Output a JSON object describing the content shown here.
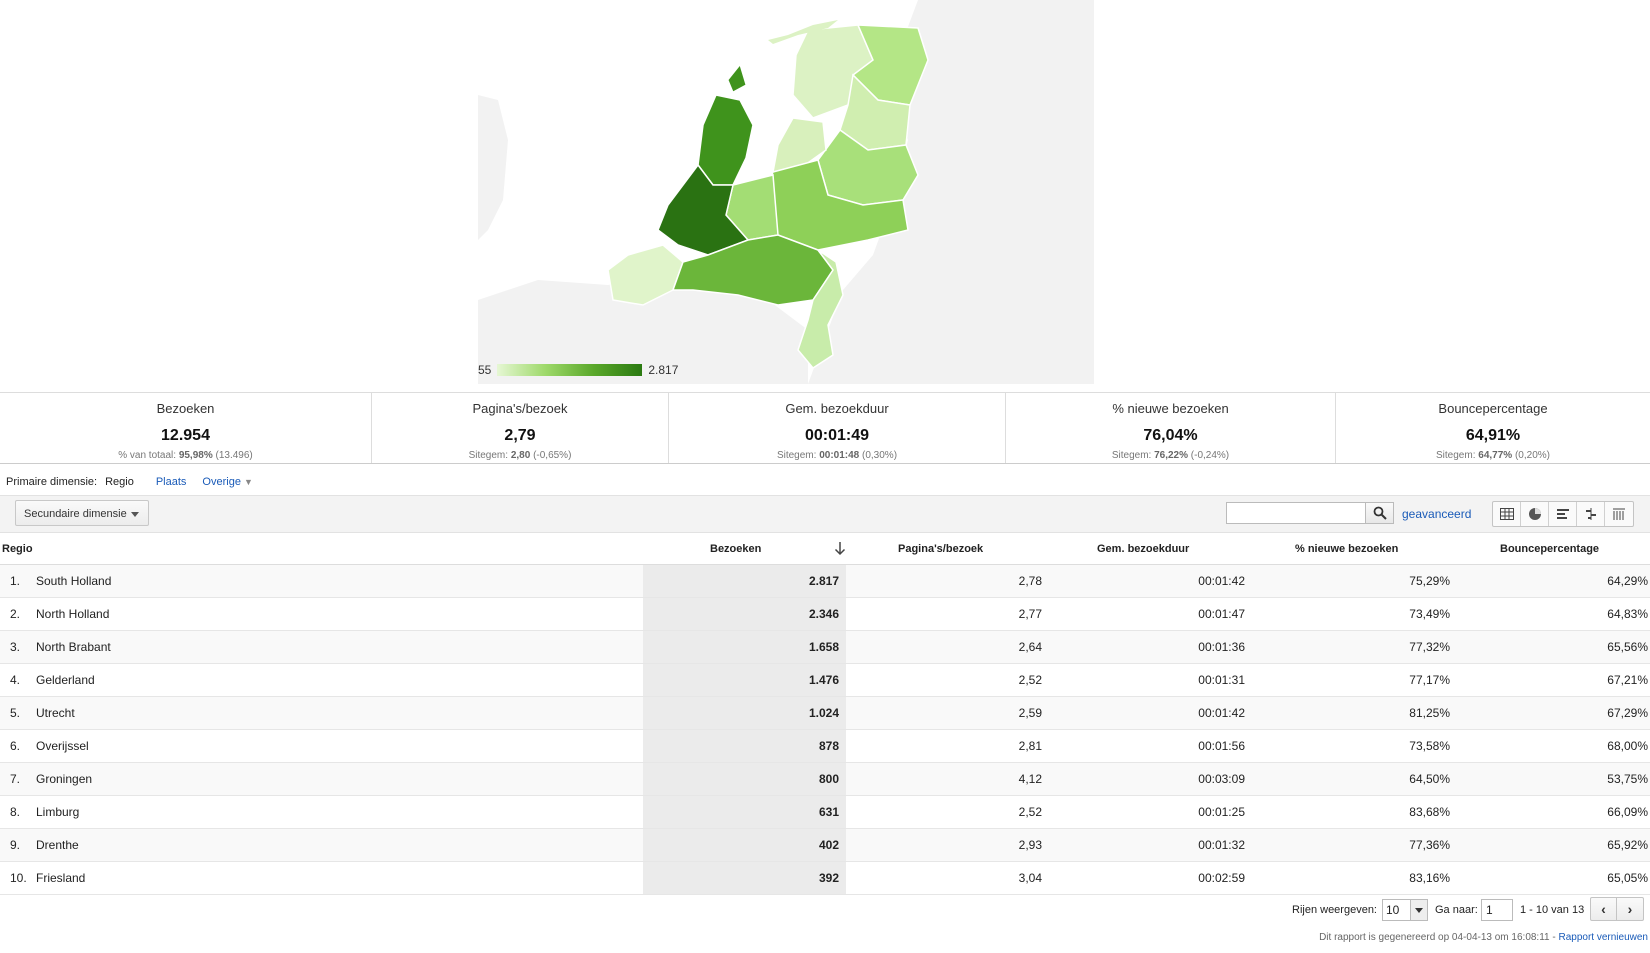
{
  "map": {
    "legend_min": "55",
    "legend_max": "2.817",
    "colors": {
      "low": "#e6f7d4",
      "mid": "#9ed96a",
      "high": "#2b7a12",
      "max": "#256e10",
      "land": "#f2f2f2"
    }
  },
  "summary": [
    {
      "title": "Bezoeken",
      "value": "12.954",
      "sub_label": "% van totaal:",
      "sub_strong": "95,98%",
      "sub_rest": "(13.496)"
    },
    {
      "title": "Pagina's/bezoek",
      "value": "2,79",
      "sub_label": "Sitegem:",
      "sub_strong": "2,80",
      "sub_rest": "(-0,65%)"
    },
    {
      "title": "Gem. bezoekduur",
      "value": "00:01:49",
      "sub_label": "Sitegem:",
      "sub_strong": "00:01:48",
      "sub_rest": "(0,30%)"
    },
    {
      "title": "% nieuwe bezoeken",
      "value": "76,04%",
      "sub_label": "Sitegem:",
      "sub_strong": "76,22%",
      "sub_rest": "(-0,24%)"
    },
    {
      "title": "Bouncepercentage",
      "value": "64,91%",
      "sub_label": "Sitegem:",
      "sub_strong": "64,77%",
      "sub_rest": "(0,20%)"
    }
  ],
  "dimension": {
    "label": "Primaire dimensie:",
    "selected": "Regio",
    "link1": "Plaats",
    "link2": "Overige"
  },
  "toolbar": {
    "secondary": "Secundaire dimensie",
    "search_placeholder": "",
    "advanced": "geavanceerd"
  },
  "table": {
    "headers": {
      "region": "Regio",
      "visits": "Bezoeken",
      "pages": "Pagina's/bezoek",
      "duration": "Gem. bezoekduur",
      "new": "% nieuwe bezoeken",
      "bounce": "Bouncepercentage"
    },
    "rows": [
      {
        "n": "1.",
        "region": "South Holland",
        "visits": "2.817",
        "pages": "2,78",
        "duration": "00:01:42",
        "new": "75,29%",
        "bounce": "64,29%"
      },
      {
        "n": "2.",
        "region": "North Holland",
        "visits": "2.346",
        "pages": "2,77",
        "duration": "00:01:47",
        "new": "73,49%",
        "bounce": "64,83%"
      },
      {
        "n": "3.",
        "region": "North Brabant",
        "visits": "1.658",
        "pages": "2,64",
        "duration": "00:01:36",
        "new": "77,32%",
        "bounce": "65,56%"
      },
      {
        "n": "4.",
        "region": "Gelderland",
        "visits": "1.476",
        "pages": "2,52",
        "duration": "00:01:31",
        "new": "77,17%",
        "bounce": "67,21%"
      },
      {
        "n": "5.",
        "region": "Utrecht",
        "visits": "1.024",
        "pages": "2,59",
        "duration": "00:01:42",
        "new": "81,25%",
        "bounce": "67,29%"
      },
      {
        "n": "6.",
        "region": "Overijssel",
        "visits": "878",
        "pages": "2,81",
        "duration": "00:01:56",
        "new": "73,58%",
        "bounce": "68,00%"
      },
      {
        "n": "7.",
        "region": "Groningen",
        "visits": "800",
        "pages": "4,12",
        "duration": "00:03:09",
        "new": "64,50%",
        "bounce": "53,75%"
      },
      {
        "n": "8.",
        "region": "Limburg",
        "visits": "631",
        "pages": "2,52",
        "duration": "00:01:25",
        "new": "83,68%",
        "bounce": "66,09%"
      },
      {
        "n": "9.",
        "region": "Drenthe",
        "visits": "402",
        "pages": "2,93",
        "duration": "00:01:32",
        "new": "77,36%",
        "bounce": "65,92%"
      },
      {
        "n": "10.",
        "region": "Friesland",
        "visits": "392",
        "pages": "3,04",
        "duration": "00:02:59",
        "new": "83,16%",
        "bounce": "65,05%"
      }
    ]
  },
  "pager": {
    "rows_label": "Rijen weergeven:",
    "rows_value": "10",
    "goto_label": "Ga naar:",
    "goto_value": "1",
    "range": "1 - 10 van 13"
  },
  "footer": {
    "text": "Dit rapport is gegenereerd op 04-04-13 om 16:08:11 -",
    "link": "Rapport vernieuwen"
  }
}
